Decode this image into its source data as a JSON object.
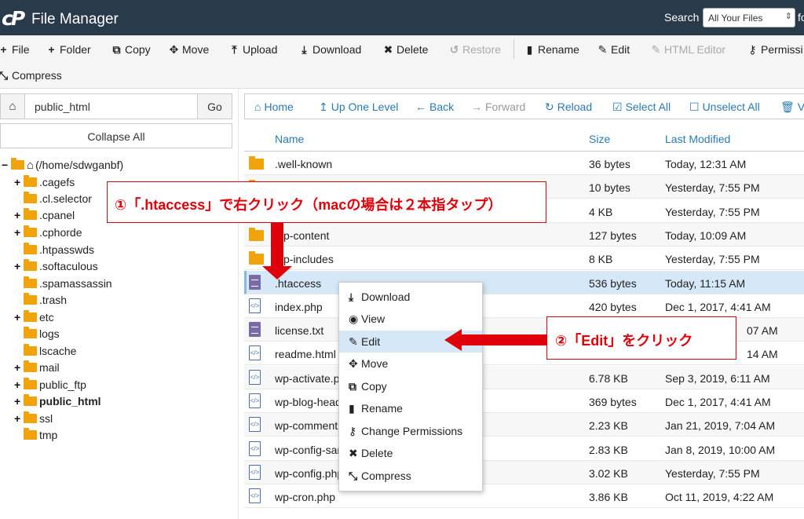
{
  "header": {
    "title": "File Manager",
    "search_label": "Search",
    "search_scope": "All Your Files",
    "search_cutoff": "fo"
  },
  "toolbar": {
    "items": [
      {
        "label": "File",
        "icon": "plus-icon"
      },
      {
        "label": "Folder",
        "icon": "plus-icon"
      },
      {
        "label": "Copy",
        "icon": "copy-icon"
      },
      {
        "label": "Move",
        "icon": "move-icon"
      },
      {
        "label": "Upload",
        "icon": "upload-icon"
      },
      {
        "label": "Download",
        "icon": "download-icon"
      },
      {
        "label": "Delete",
        "icon": "times-icon"
      },
      {
        "label": "Restore",
        "icon": "undo-icon",
        "disabled": true
      },
      {
        "label": "Rename",
        "icon": "file-icon"
      },
      {
        "label": "Edit",
        "icon": "pencil-icon"
      },
      {
        "label": "HTML Editor",
        "icon": "edit-icon",
        "disabled": true
      },
      {
        "label": "Permissi",
        "icon": "key-icon"
      },
      {
        "label": "Compress",
        "icon": "compress-icon"
      }
    ]
  },
  "left": {
    "path_value": "public_html",
    "go_label": "Go",
    "collapse_label": "Collapse All",
    "tree": [
      {
        "label": "(/home/sdwganbf)",
        "toggle": "−",
        "level": 0
      },
      {
        "label": ".cagefs",
        "toggle": "+",
        "level": 1
      },
      {
        "label": ".cl.selector",
        "toggle": "",
        "level": 1
      },
      {
        "label": ".cpanel",
        "toggle": "+",
        "level": 1
      },
      {
        "label": ".cphorde",
        "toggle": "+",
        "level": 1
      },
      {
        "label": ".htpasswds",
        "toggle": "",
        "level": 1
      },
      {
        "label": ".softaculous",
        "toggle": "+",
        "level": 1
      },
      {
        "label": ".spamassassin",
        "toggle": "",
        "level": 1
      },
      {
        "label": ".trash",
        "toggle": "",
        "level": 1
      },
      {
        "label": "etc",
        "toggle": "+",
        "level": 1
      },
      {
        "label": "logs",
        "toggle": "",
        "level": 1
      },
      {
        "label": "lscache",
        "toggle": "",
        "level": 1
      },
      {
        "label": "mail",
        "toggle": "+",
        "level": 1
      },
      {
        "label": "public_ftp",
        "toggle": "+",
        "level": 1
      },
      {
        "label": "public_html",
        "toggle": "+",
        "level": 1,
        "bold": true
      },
      {
        "label": "ssl",
        "toggle": "+",
        "level": 1
      },
      {
        "label": "tmp",
        "toggle": "",
        "level": 1
      }
    ]
  },
  "nav": {
    "items": [
      {
        "label": "Home",
        "icon": "home-icon"
      },
      {
        "label": "Up One Level",
        "icon": "level-up-icon"
      },
      {
        "label": "Back",
        "icon": "arrow-left-icon"
      },
      {
        "label": "Forward",
        "icon": "arrow-right-icon",
        "disabled": true
      },
      {
        "label": "Reload",
        "icon": "refresh-icon"
      },
      {
        "label": "Select All",
        "icon": "check-square-icon"
      },
      {
        "label": "Unselect All",
        "icon": "square-icon"
      },
      {
        "label": "Vi",
        "icon": "trash-icon"
      }
    ]
  },
  "table": {
    "columns": [
      "Name",
      "Size",
      "Last Modified"
    ],
    "rows": [
      {
        "name": ".well-known",
        "size": "36 bytes",
        "modified": "Today, 12:31 AM",
        "type": "folder"
      },
      {
        "name": "",
        "size": "10 bytes",
        "modified": "Yesterday, 7:55 PM",
        "type": "folder"
      },
      {
        "name": "",
        "size": "4 KB",
        "modified": "Yesterday, 7:55 PM",
        "type": "folder"
      },
      {
        "name": "p-content",
        "size": "127 bytes",
        "modified": "Today, 10:09 AM",
        "type": "folder"
      },
      {
        "name": "p-includes",
        "size": "8 KB",
        "modified": "Yesterday, 7:55 PM",
        "type": "folder"
      },
      {
        "name": ".htaccess",
        "size": "536 bytes",
        "modified": "Today, 11:15 AM",
        "type": "text",
        "selected": true
      },
      {
        "name": "index.php",
        "size": "420 bytes",
        "modified": "Dec 1, 2017, 4:41 AM",
        "type": "code"
      },
      {
        "name": "license.txt",
        "size": "",
        "modified": "07 AM",
        "type": "text"
      },
      {
        "name": "readme.html",
        "size": "",
        "modified": "14 AM",
        "type": "code"
      },
      {
        "name": "wp-activate.p",
        "size": "6.78 KB",
        "modified": "Sep 3, 2019, 6:11 AM",
        "type": "code"
      },
      {
        "name": "wp-blog-head",
        "size": "369 bytes",
        "modified": "Dec 1, 2017, 4:41 AM",
        "type": "code"
      },
      {
        "name": "wp-comments",
        "size": "2.23 KB",
        "modified": "Jan 21, 2019, 7:04 AM",
        "type": "code"
      },
      {
        "name": "wp-config-sar",
        "size": "2.83 KB",
        "modified": "Jan 8, 2019, 10:00 AM",
        "type": "code"
      },
      {
        "name": "wp-config.php",
        "size": "3.02 KB",
        "modified": "Yesterday, 7:55 PM",
        "type": "code"
      },
      {
        "name": "wp-cron.php",
        "size": "3.86 KB",
        "modified": "Oct 11, 2019, 4:22 AM",
        "type": "code"
      }
    ]
  },
  "context_menu": {
    "items": [
      {
        "label": "Download",
        "icon": "download-icon"
      },
      {
        "label": "View",
        "icon": "eye-icon"
      },
      {
        "label": "Edit",
        "icon": "pencil-icon",
        "highlighted": true
      },
      {
        "label": "Move",
        "icon": "move-icon"
      },
      {
        "label": "Copy",
        "icon": "copy-icon"
      },
      {
        "label": "Rename",
        "icon": "file-icon"
      },
      {
        "label": "Change Permissions",
        "icon": "key-icon"
      },
      {
        "label": "Delete",
        "icon": "times-icon"
      },
      {
        "label": "Compress",
        "icon": "compress-icon"
      }
    ]
  },
  "annotations": {
    "step1": "①「.htaccess」で右クリック（macの場合は２本指タップ）",
    "step2": "②「Edit」をクリック",
    "accent_color": "#e0000a"
  }
}
